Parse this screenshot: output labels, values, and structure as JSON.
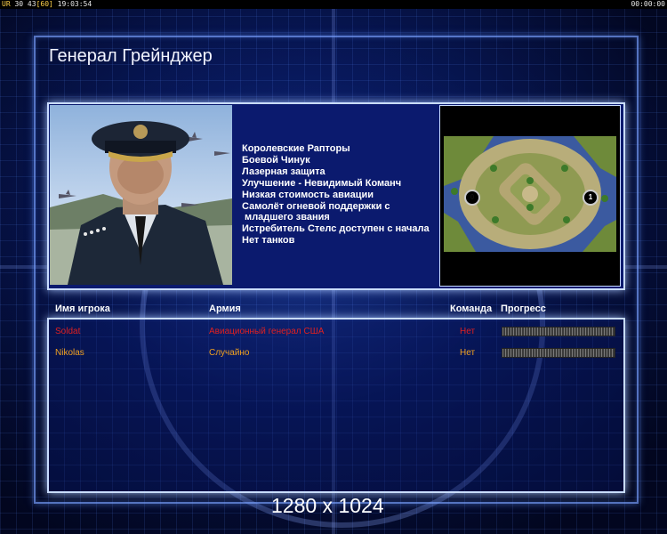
{
  "status_bar": {
    "ur_label": "UR",
    "stats": "30 43",
    "fps": "[60]",
    "clock": "19:03:54",
    "timer": "00:00:00"
  },
  "general": {
    "name": "Генерал Грейнджер",
    "features": [
      "Королевские Рапторы",
      "Боевой Чинук",
      "Лазерная защита",
      "Улучшение - Невидимый Команч",
      "Низкая стоимость авиации",
      "Самолёт огневой поддержки с",
      " младшего звания",
      "Истребитель Стелс доступен с начала",
      "Нет танков"
    ]
  },
  "minimap": {
    "player_markers": [
      "0",
      "1"
    ]
  },
  "columns": {
    "player": "Имя игрока",
    "army": "Армия",
    "team": "Команда",
    "progress": "Прогресс"
  },
  "players": [
    {
      "name": "Soldat",
      "army": "Авиационный генерал США",
      "team": "Нет",
      "progress": 1.0,
      "color": "#e02020"
    },
    {
      "name": "Nikolas",
      "army": "Случайно",
      "team": "Нет",
      "progress": 1.0,
      "color": "#f0a020"
    }
  ],
  "resolution_watermark": "1280 x 1024",
  "colors": {
    "frame": "#c9dcff",
    "panel": "#0b1a6e",
    "background": "#05103a"
  }
}
